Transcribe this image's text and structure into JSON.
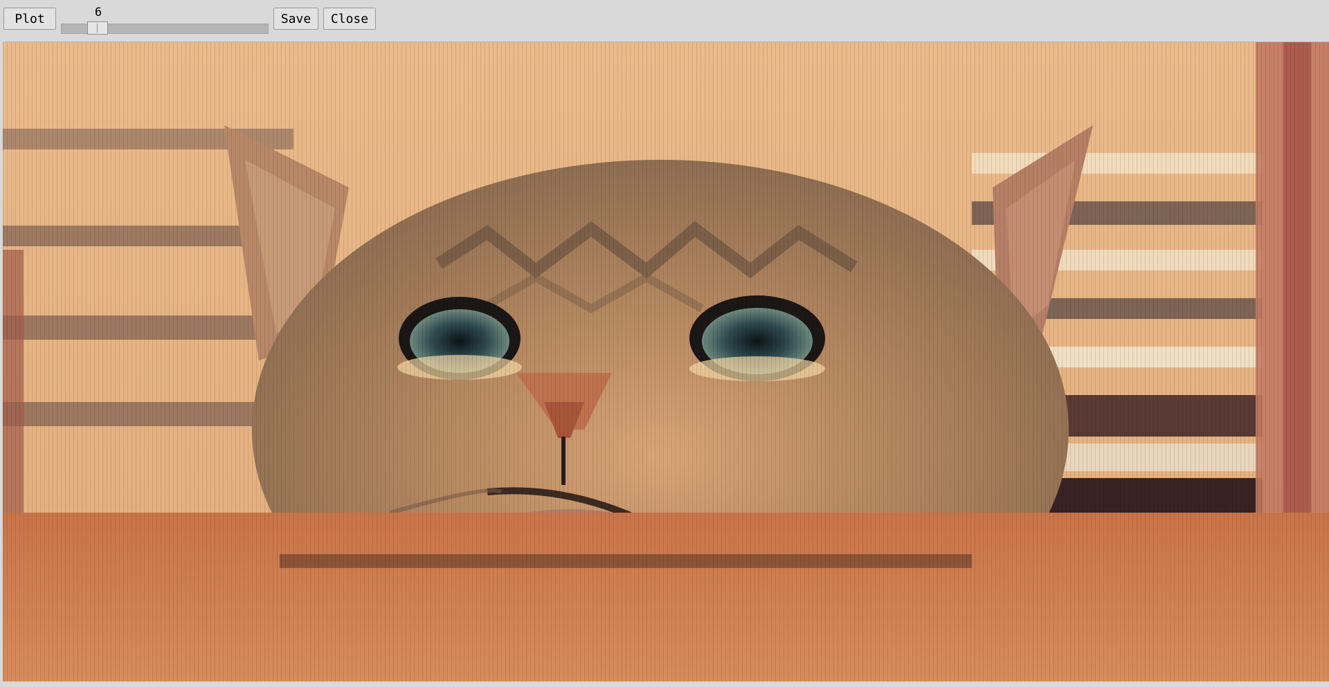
{
  "toolbar": {
    "plot_label": "Plot",
    "slider": {
      "value": "6",
      "level": 6
    },
    "save_label": "Save",
    "close_label": "Close"
  },
  "image": {
    "subject": "cat-face-pixelated",
    "colors": {
      "wall": "#e9b786",
      "table": "#d4804e",
      "fur": "#a8835f",
      "ear": "#b8836a",
      "eye": "#2c3f45",
      "nose": "#c0724e"
    }
  }
}
